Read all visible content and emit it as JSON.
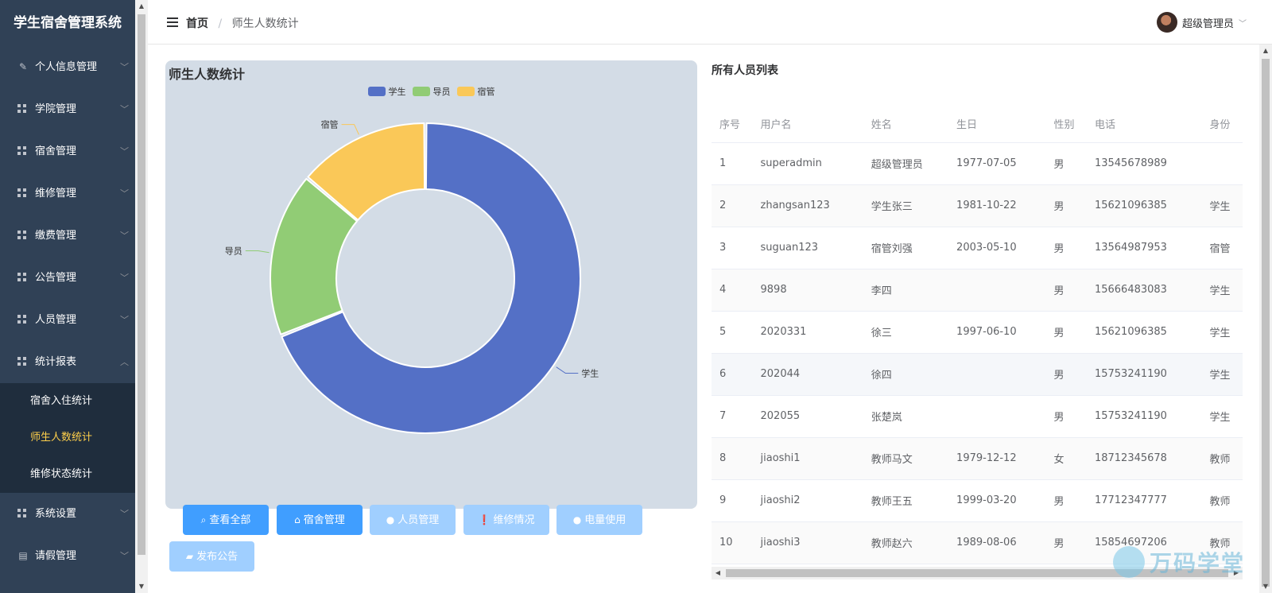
{
  "app": {
    "title": "学生宿舍管理系统"
  },
  "sidebar": {
    "items": [
      {
        "label": "个人信息管理",
        "icon": "edit-icon"
      },
      {
        "label": "学院管理",
        "icon": "grid-icon"
      },
      {
        "label": "宿舍管理",
        "icon": "grid-icon"
      },
      {
        "label": "维修管理",
        "icon": "grid-icon"
      },
      {
        "label": "缴费管理",
        "icon": "grid-icon"
      },
      {
        "label": "公告管理",
        "icon": "grid-icon"
      },
      {
        "label": "人员管理",
        "icon": "grid-icon"
      },
      {
        "label": "统计报表",
        "icon": "grid-icon",
        "expanded": true
      }
    ],
    "sub_items": [
      "宿舍入住统计",
      "师生人数统计",
      "维修状态统计"
    ],
    "active_sub": "师生人数统计",
    "items_after": [
      {
        "label": "系统设置",
        "icon": "grid-icon"
      },
      {
        "label": "请假管理",
        "icon": "document-icon"
      }
    ],
    "active_color": "#ffd04b",
    "bg_color": "#304156"
  },
  "header": {
    "breadcrumb_home": "首页",
    "breadcrumb_sep": "/",
    "breadcrumb_current": "师生人数统计",
    "user_name": "超级管理员"
  },
  "chart_card": {
    "title": "师生人数统计"
  },
  "chart_data": {
    "type": "pie",
    "donut": true,
    "categories": [
      "学生",
      "导员",
      "宿管"
    ],
    "values": [
      6,
      1.5,
      1.2
    ],
    "colors": [
      "#5470c6",
      "#91cc75",
      "#fac858"
    ],
    "legend_position": "top-center"
  },
  "buttons": [
    {
      "label": "查看全部",
      "icon": "search-icon",
      "state": "primary"
    },
    {
      "label": "宿舍管理",
      "icon": "home-icon",
      "state": "primary"
    },
    {
      "label": "人员管理",
      "icon": "user-icon",
      "state": "disabled"
    },
    {
      "label": "维修情况",
      "icon": "info-icon",
      "state": "disabled"
    },
    {
      "label": "电量使用",
      "icon": "location-icon",
      "state": "disabled"
    },
    {
      "label": "发布公告",
      "icon": "chat-icon",
      "state": "disabled"
    }
  ],
  "people_list": {
    "title": "所有人员列表",
    "columns": [
      "序号",
      "用户名",
      "姓名",
      "生日",
      "性别",
      "电话",
      "身份"
    ],
    "rows": [
      [
        "1",
        "superadmin",
        "超级管理员",
        "1977-07-05",
        "男",
        "13545678989",
        ""
      ],
      [
        "2",
        "zhangsan123",
        "学生张三",
        "1981-10-22",
        "男",
        "15621096385",
        "学生"
      ],
      [
        "3",
        "suguan123",
        "宿管刘强",
        "2003-05-10",
        "男",
        "13564987953",
        "宿管"
      ],
      [
        "4",
        "9898",
        "李四",
        "",
        "男",
        "15666483083",
        "学生"
      ],
      [
        "5",
        "2020331",
        "徐三",
        "1997-06-10",
        "男",
        "15621096385",
        "学生"
      ],
      [
        "6",
        "202044",
        "徐四",
        "",
        "男",
        "15753241190",
        "学生"
      ],
      [
        "7",
        "202055",
        "张楚岚",
        "",
        "男",
        "15753241190",
        "学生"
      ],
      [
        "8",
        "jiaoshi1",
        "教师马文",
        "1979-12-12",
        "女",
        "18712345678",
        "教师"
      ],
      [
        "9",
        "jiaoshi2",
        "教师王五",
        "1999-03-20",
        "男",
        "17712347777",
        "教师"
      ],
      [
        "10",
        "jiaoshi3",
        "教师赵六",
        "1989-08-06",
        "男",
        "15854697206",
        "教师"
      ]
    ]
  },
  "watermark": {
    "text": "万码学堂"
  }
}
